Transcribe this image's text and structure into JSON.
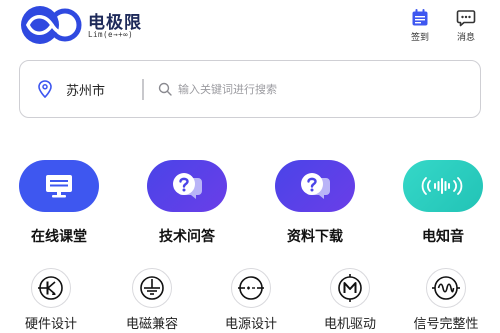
{
  "brand": {
    "name": "电极限",
    "slogan": "Lim(e→+∞)",
    "color": "#2f49e0"
  },
  "header": {
    "signin_label": "签到",
    "messages_label": "消息"
  },
  "search": {
    "city": "苏州市",
    "placeholder": "输入关键词进行搜索"
  },
  "features": [
    {
      "label": "在线课堂",
      "icon": "monitor-icon",
      "color": "#3e57f0"
    },
    {
      "label": "技术问答",
      "icon": "question-bubble-icon",
      "color": "#5a40e8"
    },
    {
      "label": "资料下载",
      "icon": "question-bubble-icon",
      "color": "#5a40e8"
    },
    {
      "label": "电知音",
      "icon": "audio-wave-icon",
      "color": "#2cccbe"
    }
  ],
  "tools": [
    {
      "label": "硬件设计",
      "icon": "diode-symbol-icon"
    },
    {
      "label": "电磁兼容",
      "icon": "ground-symbol-icon"
    },
    {
      "label": "电源设计",
      "icon": "battery-symbol-icon"
    },
    {
      "label": "电机驱动",
      "icon": "motor-symbol-icon"
    },
    {
      "label": "信号完整性",
      "icon": "signal-wave-icon"
    }
  ]
}
